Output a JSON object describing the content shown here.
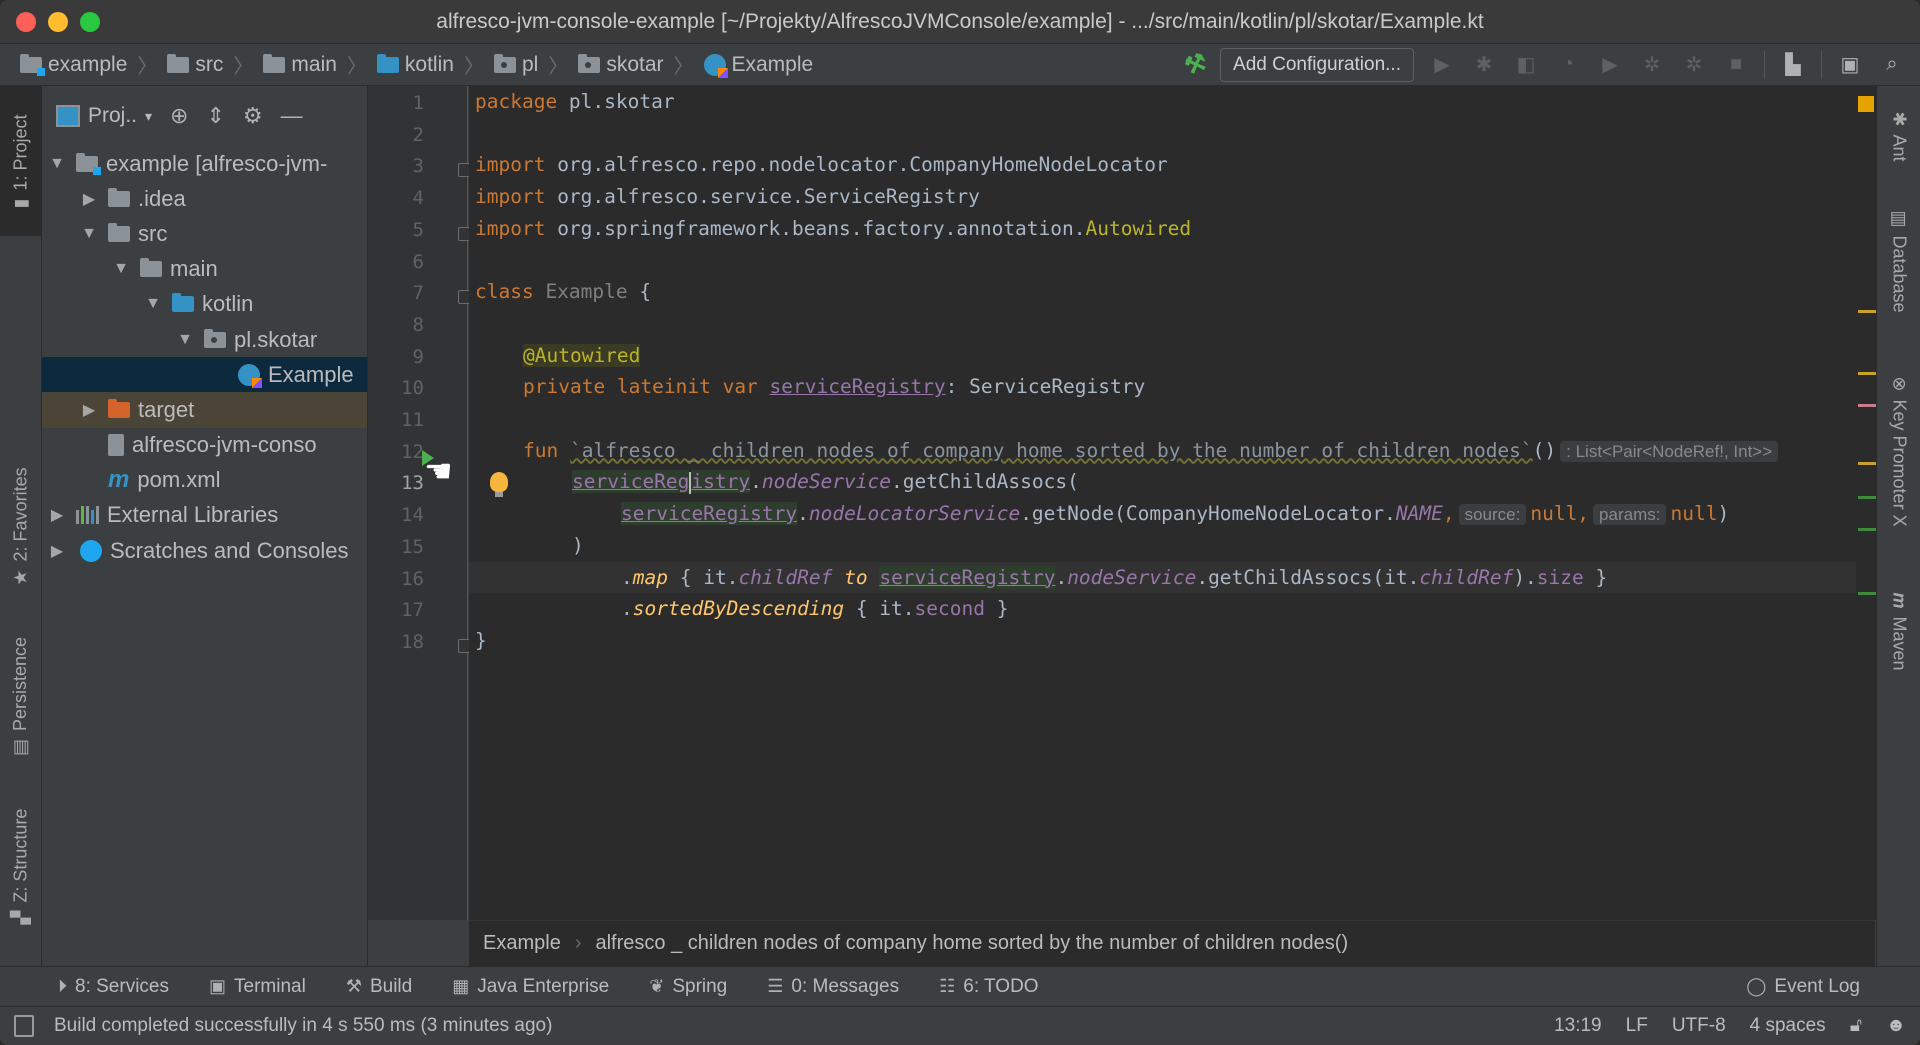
{
  "window": {
    "title": "alfresco-jvm-console-example [~/Projekty/AlfrescoJVMConsole/example] - .../src/main/kotlin/pl/skotar/Example.kt"
  },
  "navbar": {
    "breadcrumbs": [
      "example",
      "src",
      "main",
      "kotlin",
      "pl",
      "skotar",
      "Example"
    ],
    "add_configuration": "Add Configuration..."
  },
  "left_stripe": {
    "project": "1: Project",
    "favorites": "2: Favorites",
    "persistence": "Persistence",
    "structure": "Z: Structure"
  },
  "project_panel": {
    "view_selector": "Proj..",
    "tree": [
      {
        "label": "example [alfresco-jvm-",
        "expanded": true,
        "level": 0,
        "icon": "module-folder-icon"
      },
      {
        "label": ".idea",
        "expanded": false,
        "level": 1,
        "icon": "folder-icon"
      },
      {
        "label": "src",
        "expanded": true,
        "level": 1,
        "icon": "folder-icon"
      },
      {
        "label": "main",
        "expanded": true,
        "level": 2,
        "icon": "folder-icon"
      },
      {
        "label": "kotlin",
        "expanded": true,
        "level": 3,
        "icon": "source-folder-icon"
      },
      {
        "label": "pl.skotar",
        "expanded": true,
        "level": 4,
        "icon": "package-icon"
      },
      {
        "label": "Example",
        "level": 5,
        "icon": "kotlin-class-icon",
        "selected": true
      },
      {
        "label": "target",
        "expanded": false,
        "level": 1,
        "icon": "excluded-folder-icon"
      },
      {
        "label": "alfresco-jvm-conso",
        "level": 1,
        "icon": "iml-file-icon"
      },
      {
        "label": "pom.xml",
        "level": 1,
        "icon": "maven-icon"
      },
      {
        "label": "External Libraries",
        "expanded": false,
        "level": 0,
        "icon": "libraries-icon"
      },
      {
        "label": "Scratches and Consoles",
        "expanded": false,
        "level": 0,
        "icon": "scratches-icon"
      }
    ]
  },
  "editor": {
    "line_numbers": [
      "1",
      "2",
      "3",
      "4",
      "5",
      "6",
      "7",
      "8",
      "9",
      "10",
      "11",
      "12",
      "13",
      "14",
      "15",
      "16",
      "17",
      "18"
    ],
    "current_line": "13",
    "code": {
      "l1_kw": "package",
      "l1_rest": " pl.skotar",
      "l3_kw": "import",
      "l3_rest": " org.alfresco.repo.nodelocator.CompanyHomeNodeLocator",
      "l4_kw": "import",
      "l4_rest": " org.alfresco.service.ServiceRegistry",
      "l5_kw": "import",
      "l5_rest": " org.springframework.beans.factory.annotation.",
      "l5_ann": "Autowired",
      "l7_kw": "class",
      "l7_name": " Example",
      "l7_rest": " {",
      "l9_ann": "@Autowired",
      "l10_kw": "private lateinit var ",
      "l10_prop": "serviceRegistry",
      "l10_rest": ": ServiceRegistry",
      "l12_kw": "fun ",
      "l12_name": "`alfresco _ children nodes of company home sorted by the number of children nodes`",
      "l12_rest": "()",
      "l12_hint": ": List<Pair<NodeRef!, Int>>",
      "l13_prop_a": "serviceReg",
      "l13_prop_b": "istry",
      "l13_dot": ".",
      "l13_ital": "nodeService",
      "l13_rest": ".getChildAssocs(",
      "l14_prop": "serviceRegistry",
      "l14_dot": ".",
      "l14_ital": "nodeLocatorService",
      "l14_rest": ".getNode(CompanyHomeNodeLocator.",
      "l14_const": "NAME",
      "l14_comma": ",",
      "l14_hint1": "source:",
      "l14_null1": "null,",
      "l14_hint2": "params:",
      "l14_null2": "null",
      "l14_close": ")",
      "l15": ")",
      "l16_a": ".",
      "l16_map": "map",
      "l16_b": " { it.",
      "l16_child": "childRef",
      "l16_to": " to ",
      "l16_prop": "serviceRegistry",
      "l16_c": ".",
      "l16_ns": "nodeService",
      "l16_d": ".getChildAssocs(it.",
      "l16_child2": "childRef",
      "l16_e": ").",
      "l16_size": "size",
      "l16_f": " }",
      "l17_a": ".",
      "l17_fn": "sortedByDescending",
      "l17_b": " { it.",
      "l17_second": "second",
      "l17_c": " }",
      "l18": "}"
    },
    "breadcrumb": [
      "Example",
      "alfresco _ children nodes of company home sorted by the number of children nodes()"
    ]
  },
  "right_stripe": {
    "ant": "Ant",
    "database": "Database",
    "key_promoter": "Key Promoter X",
    "maven": "Maven"
  },
  "tool_tabs": [
    {
      "label": "8: Services",
      "icon": "services-icon"
    },
    {
      "label": "Terminal",
      "icon": "terminal-icon"
    },
    {
      "label": "Build",
      "icon": "build-icon"
    },
    {
      "label": "Java Enterprise",
      "icon": "java-enterprise-icon"
    },
    {
      "label": "Spring",
      "icon": "spring-icon"
    },
    {
      "label": "0: Messages",
      "icon": "messages-icon"
    },
    {
      "label": "6: TODO",
      "icon": "todo-icon"
    }
  ],
  "event_log": "Event Log",
  "status_bar": {
    "message": "Build completed successfully in 4 s 550 ms (3 minutes ago)",
    "position": "13:19",
    "line_ending": "LF",
    "encoding": "UTF-8",
    "indent": "4 spaces"
  },
  "colors": {
    "keyword": "#cc7832",
    "annotation": "#bbb529",
    "property": "#9876aa",
    "function_ext": "#ffc66d",
    "selection": "#0d293e"
  }
}
